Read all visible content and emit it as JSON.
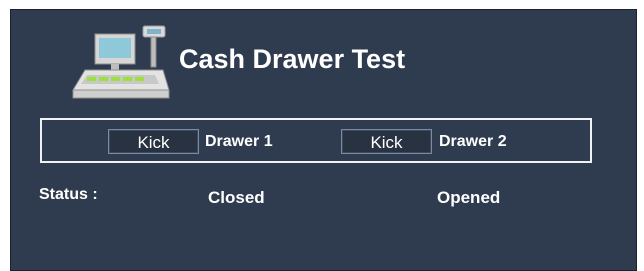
{
  "app": {
    "title": "Cash Drawer Test",
    "icon": "cash-register-icon"
  },
  "drawers": [
    {
      "button_label": "Kick",
      "name": "Drawer 1",
      "status": "Closed"
    },
    {
      "button_label": "Kick",
      "name": "Drawer 2",
      "status": "Opened"
    }
  ],
  "status": {
    "label": "Status :"
  },
  "colors": {
    "background": "#2f3b4e",
    "text": "#ffffff",
    "panel_border": "#f2f2f2"
  }
}
